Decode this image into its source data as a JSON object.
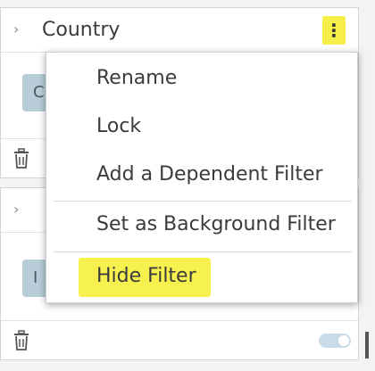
{
  "panels": [
    {
      "title": "Country",
      "chevron": "›",
      "kebab": "⋮",
      "chip_text": "C",
      "accent_color": "#f6ef4a"
    },
    {
      "title": "",
      "chevron": "›",
      "chip_text": "I",
      "toggle_state": "on"
    }
  ],
  "icons": {
    "chevron": "chevron-right-icon",
    "kebab": "kebab-menu-icon",
    "trash": "trash-icon",
    "toggle": "toggle-switch"
  },
  "menu": {
    "items": [
      {
        "label": "Rename"
      },
      {
        "label": "Lock"
      },
      {
        "label": "Add a Dependent Filter"
      },
      {
        "label": "Set as Background Filter"
      },
      {
        "label": "Hide Filter",
        "highlighted": true
      }
    ],
    "highlight_color": "#f7f14f"
  }
}
